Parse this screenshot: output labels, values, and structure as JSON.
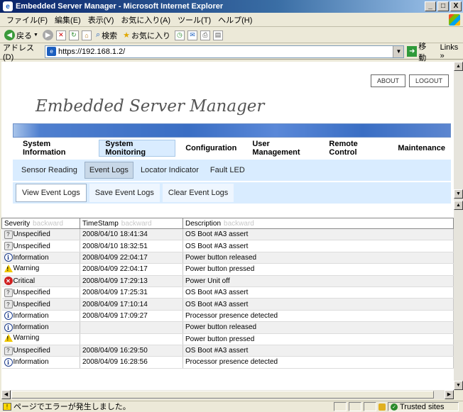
{
  "window": {
    "title": "Embedded Server Manager - Microsoft Internet Explorer",
    "ie_icon": "ie-logo-icon",
    "controls": [
      "_",
      "□",
      "X"
    ]
  },
  "menu": {
    "items": [
      "ファイル(F)",
      "編集(E)",
      "表示(V)",
      "お気に入り(A)",
      "ツール(T)",
      "ヘルプ(H)"
    ]
  },
  "toolbar": {
    "back_label": "戻る",
    "search_label": "検索",
    "favorites_label": "お気に入り"
  },
  "address": {
    "label": "アドレス(D)",
    "url": "https://192.168.1.2/",
    "go_label": "移動",
    "links_label": "Links »"
  },
  "page": {
    "about_label": "ABOUT",
    "logout_label": "LOGOUT",
    "app_title": "Embedded Server Manager",
    "main_tabs": [
      "System Information",
      "System Monitoring",
      "Configuration",
      "User Management",
      "Remote Control",
      "Maintenance"
    ],
    "sub_tabs": [
      "Sensor Reading",
      "Event Logs",
      "Locator Indicator",
      "Fault LED"
    ],
    "log_tabs": [
      "View Event Logs",
      "Save Event Logs",
      "Clear Event Logs"
    ],
    "table": {
      "columns": [
        {
          "label": "Severity",
          "sort": "backward"
        },
        {
          "label": "TimeStamp",
          "sort": "backward"
        },
        {
          "label": "Description",
          "sort": "backward"
        }
      ],
      "rows": [
        {
          "severity": "Unspecified",
          "icon": "unspecified-icon",
          "timestamp": "2008/04/10 18:41:34",
          "description": "OS Boot #A3 assert"
        },
        {
          "severity": "Unspecified",
          "icon": "unspecified-icon",
          "timestamp": "2008/04/10 18:32:51",
          "description": "OS Boot #A3 assert"
        },
        {
          "severity": "Information",
          "icon": "info-icon",
          "timestamp": "2008/04/09 22:04:17",
          "description": "Power button released"
        },
        {
          "severity": "Warning",
          "icon": "warning-icon",
          "timestamp": "2008/04/09 22:04:17",
          "description": "Power button pressed"
        },
        {
          "severity": "Critical",
          "icon": "critical-icon",
          "timestamp": "2008/04/09 17:29:13",
          "description": "Power Unit off"
        },
        {
          "severity": "Unspecified",
          "icon": "unspecified-icon",
          "timestamp": "2008/04/09 17:25:31",
          "description": "OS Boot #A3 assert"
        },
        {
          "severity": "Unspecified",
          "icon": "unspecified-icon",
          "timestamp": "2008/04/09 17:10:14",
          "description": "OS Boot #A3 assert"
        },
        {
          "severity": "Information",
          "icon": "info-icon",
          "timestamp": "2008/04/09 17:09:27",
          "description": "Processor presence detected"
        },
        {
          "severity": "Information",
          "icon": "info-icon",
          "timestamp": "",
          "description": "Power button released"
        },
        {
          "severity": "Warning",
          "icon": "warning-icon",
          "timestamp": "",
          "description": "Power button pressed"
        },
        {
          "severity": "Unspecified",
          "icon": "unspecified-icon",
          "timestamp": "2008/04/09 16:29:50",
          "description": "OS Boot #A3 assert"
        },
        {
          "severity": "Information",
          "icon": "info-icon",
          "timestamp": "2008/04/09 16:28:56",
          "description": "Processor presence detected"
        }
      ]
    }
  },
  "status": {
    "message": "ページでエラーが発生しました。",
    "zone": "Trusted sites"
  },
  "colors": {
    "tab_active_bg": "#d9ecff",
    "band_blue": "#3a6ec4",
    "critical": "#d02020",
    "warning": "#f0c800"
  }
}
